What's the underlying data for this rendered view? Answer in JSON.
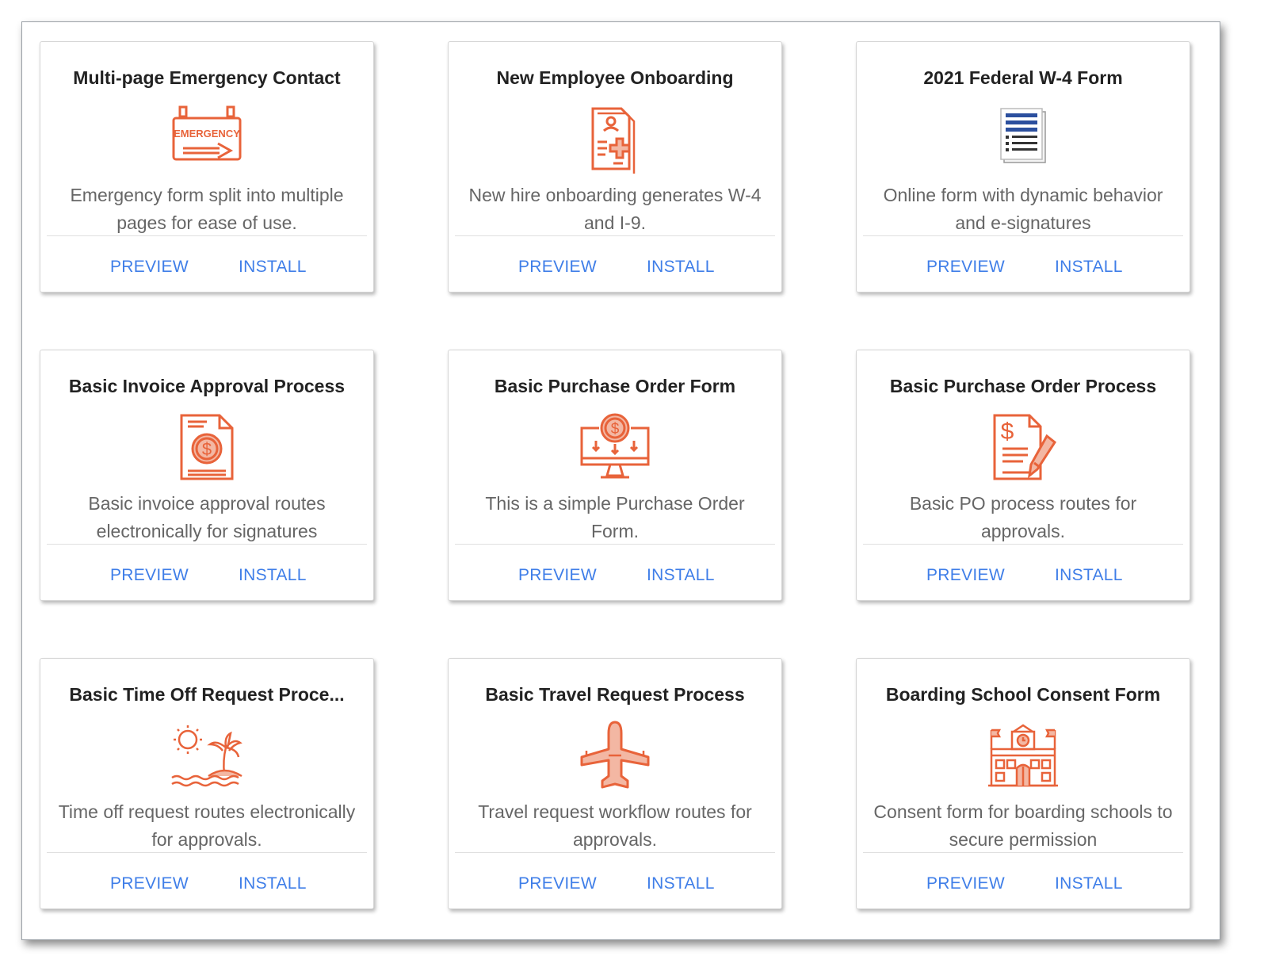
{
  "colors": {
    "accent": "#3f7ee8",
    "icon": "#e8633a",
    "title": "#222222",
    "text": "#666666"
  },
  "cards": [
    {
      "title": "Multi-page Emergency Contact",
      "icon": "emergency-sign-icon",
      "icon_text": "EMERGENCY",
      "desc": "Emergency form split into multiple pages for ease of use.",
      "preview": "PREVIEW",
      "install": "INSTALL"
    },
    {
      "title": "New Employee Onboarding",
      "icon": "medical-document-icon",
      "desc": "New hire onboarding generates W-4 and I-9.",
      "preview": "PREVIEW",
      "install": "INSTALL"
    },
    {
      "title": "2021 Federal W-4 Form",
      "icon": "document-list-icon",
      "desc": "Online form with dynamic behavior and e-signatures",
      "preview": "PREVIEW",
      "install": "INSTALL"
    },
    {
      "title": "Basic Invoice Approval Process",
      "icon": "invoice-dollar-icon",
      "desc": "Basic invoice approval routes electronically for signatures",
      "preview": "PREVIEW",
      "install": "INSTALL"
    },
    {
      "title": "Basic Purchase Order Form",
      "icon": "monitor-dollar-icon",
      "desc": "This is a simple Purchase Order Form.",
      "preview": "PREVIEW",
      "install": "INSTALL"
    },
    {
      "title": "Basic Purchase Order Process",
      "icon": "document-pen-dollar-icon",
      "desc": "Basic PO process routes for approvals.",
      "preview": "PREVIEW",
      "install": "INSTALL"
    },
    {
      "title": "Basic Time Off Request Proce...",
      "icon": "island-sun-icon",
      "desc": "Time off request routes electronically for approvals.",
      "preview": "PREVIEW",
      "install": "INSTALL"
    },
    {
      "title": "Basic Travel Request Process",
      "icon": "airplane-icon",
      "desc": "Travel request workflow routes for approvals.",
      "preview": "PREVIEW",
      "install": "INSTALL"
    },
    {
      "title": "Boarding School Consent Form",
      "icon": "school-building-icon",
      "desc": "Consent form for boarding schools to secure permission",
      "preview": "PREVIEW",
      "install": "INSTALL"
    }
  ]
}
